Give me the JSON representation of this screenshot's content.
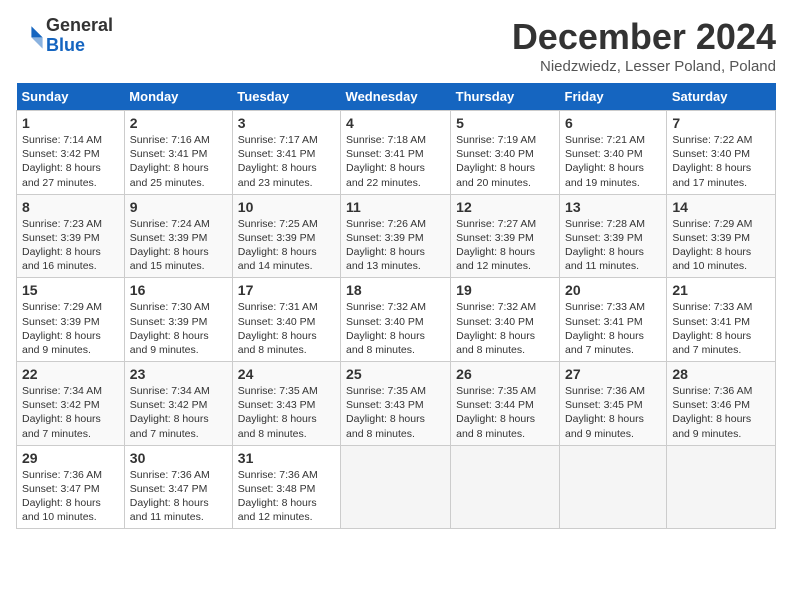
{
  "header": {
    "logo_general": "General",
    "logo_blue": "Blue",
    "title": "December 2024",
    "location": "Niedzwiedz, Lesser Poland, Poland"
  },
  "days_of_week": [
    "Sunday",
    "Monday",
    "Tuesday",
    "Wednesday",
    "Thursday",
    "Friday",
    "Saturday"
  ],
  "weeks": [
    [
      {
        "day": 1,
        "info": "Sunrise: 7:14 AM\nSunset: 3:42 PM\nDaylight: 8 hours and 27 minutes."
      },
      {
        "day": 2,
        "info": "Sunrise: 7:16 AM\nSunset: 3:41 PM\nDaylight: 8 hours and 25 minutes."
      },
      {
        "day": 3,
        "info": "Sunrise: 7:17 AM\nSunset: 3:41 PM\nDaylight: 8 hours and 23 minutes."
      },
      {
        "day": 4,
        "info": "Sunrise: 7:18 AM\nSunset: 3:41 PM\nDaylight: 8 hours and 22 minutes."
      },
      {
        "day": 5,
        "info": "Sunrise: 7:19 AM\nSunset: 3:40 PM\nDaylight: 8 hours and 20 minutes."
      },
      {
        "day": 6,
        "info": "Sunrise: 7:21 AM\nSunset: 3:40 PM\nDaylight: 8 hours and 19 minutes."
      },
      {
        "day": 7,
        "info": "Sunrise: 7:22 AM\nSunset: 3:40 PM\nDaylight: 8 hours and 17 minutes."
      }
    ],
    [
      {
        "day": 8,
        "info": "Sunrise: 7:23 AM\nSunset: 3:39 PM\nDaylight: 8 hours and 16 minutes."
      },
      {
        "day": 9,
        "info": "Sunrise: 7:24 AM\nSunset: 3:39 PM\nDaylight: 8 hours and 15 minutes."
      },
      {
        "day": 10,
        "info": "Sunrise: 7:25 AM\nSunset: 3:39 PM\nDaylight: 8 hours and 14 minutes."
      },
      {
        "day": 11,
        "info": "Sunrise: 7:26 AM\nSunset: 3:39 PM\nDaylight: 8 hours and 13 minutes."
      },
      {
        "day": 12,
        "info": "Sunrise: 7:27 AM\nSunset: 3:39 PM\nDaylight: 8 hours and 12 minutes."
      },
      {
        "day": 13,
        "info": "Sunrise: 7:28 AM\nSunset: 3:39 PM\nDaylight: 8 hours and 11 minutes."
      },
      {
        "day": 14,
        "info": "Sunrise: 7:29 AM\nSunset: 3:39 PM\nDaylight: 8 hours and 10 minutes."
      }
    ],
    [
      {
        "day": 15,
        "info": "Sunrise: 7:29 AM\nSunset: 3:39 PM\nDaylight: 8 hours and 9 minutes."
      },
      {
        "day": 16,
        "info": "Sunrise: 7:30 AM\nSunset: 3:39 PM\nDaylight: 8 hours and 9 minutes."
      },
      {
        "day": 17,
        "info": "Sunrise: 7:31 AM\nSunset: 3:40 PM\nDaylight: 8 hours and 8 minutes."
      },
      {
        "day": 18,
        "info": "Sunrise: 7:32 AM\nSunset: 3:40 PM\nDaylight: 8 hours and 8 minutes."
      },
      {
        "day": 19,
        "info": "Sunrise: 7:32 AM\nSunset: 3:40 PM\nDaylight: 8 hours and 8 minutes."
      },
      {
        "day": 20,
        "info": "Sunrise: 7:33 AM\nSunset: 3:41 PM\nDaylight: 8 hours and 7 minutes."
      },
      {
        "day": 21,
        "info": "Sunrise: 7:33 AM\nSunset: 3:41 PM\nDaylight: 8 hours and 7 minutes."
      }
    ],
    [
      {
        "day": 22,
        "info": "Sunrise: 7:34 AM\nSunset: 3:42 PM\nDaylight: 8 hours and 7 minutes."
      },
      {
        "day": 23,
        "info": "Sunrise: 7:34 AM\nSunset: 3:42 PM\nDaylight: 8 hours and 7 minutes."
      },
      {
        "day": 24,
        "info": "Sunrise: 7:35 AM\nSunset: 3:43 PM\nDaylight: 8 hours and 8 minutes."
      },
      {
        "day": 25,
        "info": "Sunrise: 7:35 AM\nSunset: 3:43 PM\nDaylight: 8 hours and 8 minutes."
      },
      {
        "day": 26,
        "info": "Sunrise: 7:35 AM\nSunset: 3:44 PM\nDaylight: 8 hours and 8 minutes."
      },
      {
        "day": 27,
        "info": "Sunrise: 7:36 AM\nSunset: 3:45 PM\nDaylight: 8 hours and 9 minutes."
      },
      {
        "day": 28,
        "info": "Sunrise: 7:36 AM\nSunset: 3:46 PM\nDaylight: 8 hours and 9 minutes."
      }
    ],
    [
      {
        "day": 29,
        "info": "Sunrise: 7:36 AM\nSunset: 3:47 PM\nDaylight: 8 hours and 10 minutes."
      },
      {
        "day": 30,
        "info": "Sunrise: 7:36 AM\nSunset: 3:47 PM\nDaylight: 8 hours and 11 minutes."
      },
      {
        "day": 31,
        "info": "Sunrise: 7:36 AM\nSunset: 3:48 PM\nDaylight: 8 hours and 12 minutes."
      },
      null,
      null,
      null,
      null
    ]
  ]
}
